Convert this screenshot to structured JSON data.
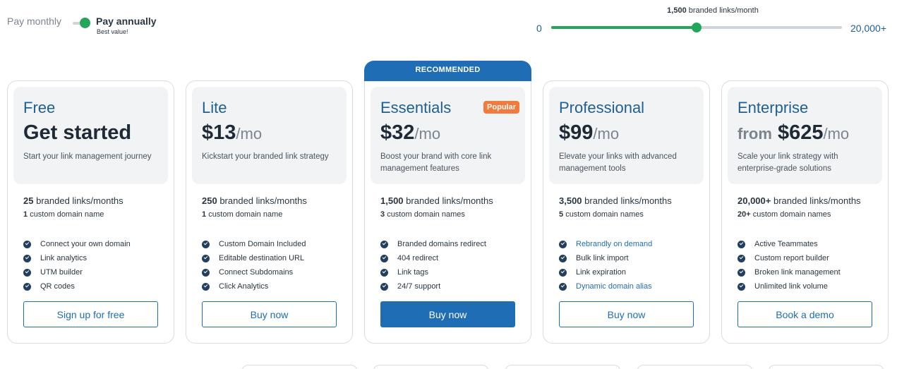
{
  "billing": {
    "monthly_label": "Pay monthly",
    "annual_label": "Pay annually",
    "annual_note": "Best value!",
    "annual_selected": true,
    "toggle_color": "#21a65a"
  },
  "volume": {
    "value_label": "1,500",
    "unit_label": "branded links/month",
    "min_label": "0",
    "max_label": "20,000+",
    "position_fraction": 0.5
  },
  "plans": [
    {
      "name": "Free",
      "price": "Get started",
      "description": "Start your link management journey",
      "links": "25",
      "links_unit": "branded links/months",
      "domains": "1",
      "domains_unit": "custom domain name",
      "features": [
        {
          "label": "Connect your own domain",
          "link": false
        },
        {
          "label": "Link analytics",
          "link": false
        },
        {
          "label": "UTM builder",
          "link": false
        },
        {
          "label": "QR codes",
          "link": false
        }
      ],
      "cta": "Sign up for free"
    },
    {
      "name": "Lite",
      "price": "$13",
      "per": "/mo",
      "description": "Kickstart your branded link strategy",
      "links": "250",
      "links_unit": "branded links/months",
      "domains": "1",
      "domains_unit": "custom domain name",
      "features": [
        {
          "label": "Custom Domain Included",
          "link": false
        },
        {
          "label": "Editable destination URL",
          "link": false
        },
        {
          "label": "Connect Subdomains",
          "link": false
        },
        {
          "label": "Click Analytics",
          "link": false
        }
      ],
      "cta": "Buy now"
    },
    {
      "name": "Essentials",
      "ribbon": "RECOMMENDED",
      "badge": "Popular",
      "price": "$32",
      "per": "/mo",
      "description": "Boost your brand with core link management features",
      "links": "1,500",
      "links_unit": "branded links/months",
      "domains": "3",
      "domains_unit": "custom domain names",
      "features": [
        {
          "label": "Branded domains redirect",
          "link": false
        },
        {
          "label": "404 redirect",
          "link": false
        },
        {
          "label": "Link tags",
          "link": false
        },
        {
          "label": "24/7 support",
          "link": false
        }
      ],
      "cta": "Buy now"
    },
    {
      "name": "Professional",
      "price": "$99",
      "per": "/mo",
      "description": "Elevate your links with advanced management tools",
      "links": "3,500",
      "links_unit": "branded links/months",
      "domains": "5",
      "domains_unit": "custom domain names",
      "features": [
        {
          "label": "Rebrandly on demand",
          "link": true
        },
        {
          "label": "Bulk link import",
          "link": false
        },
        {
          "label": "Link expiration",
          "link": false
        },
        {
          "label": "Dynamic domain alias",
          "link": true
        }
      ],
      "cta": "Buy now"
    },
    {
      "name": "Enterprise",
      "price_prefix": "from",
      "price": "$625",
      "per": "/mo",
      "description": "Scale your link strategy with enterprise-grade solutions",
      "links": "20,000+",
      "links_unit": "branded links/months",
      "domains": "20+",
      "domains_unit": "custom domain names",
      "features": [
        {
          "label": "Active Teammates",
          "link": false
        },
        {
          "label": "Custom report builder",
          "link": false
        },
        {
          "label": "Broken link management",
          "link": false
        },
        {
          "label": "Unlimited link volume",
          "link": false
        }
      ],
      "cta": "Book a demo"
    }
  ],
  "colors": {
    "accent": "#1f6eb5",
    "title": "#1f5f93",
    "green": "#21a65a",
    "badge": "#f47a3c"
  }
}
